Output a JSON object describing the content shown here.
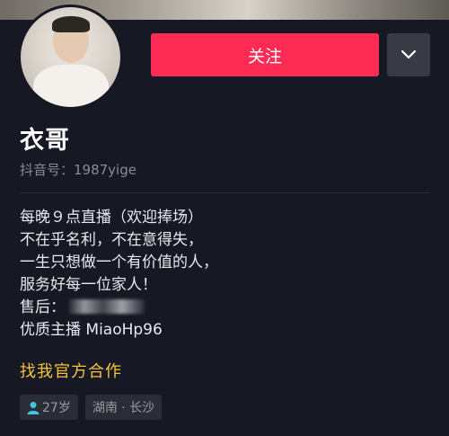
{
  "profile": {
    "follow_label": "关注",
    "username": "衣哥",
    "douyin_id": "抖音号：1987yige"
  },
  "bio": {
    "line1": "每晚９点直播（欢迎捧场）",
    "line2": "不在乎名利，不在意得失，",
    "line3": "一生只想做一个有价值的人，",
    "line4": "服务好每一位家人！",
    "line5_label": "售后：",
    "line6": "优质主播 MiaoHp96"
  },
  "collab_link": "找我官方合作",
  "tags": {
    "age": "27岁",
    "location": "湖南 · 长沙"
  },
  "colors": {
    "background": "#161824",
    "follow": "#fe2c55",
    "link": "#f7c23b"
  },
  "icons": {
    "more": "chevron-down-icon",
    "age": "person-icon"
  }
}
